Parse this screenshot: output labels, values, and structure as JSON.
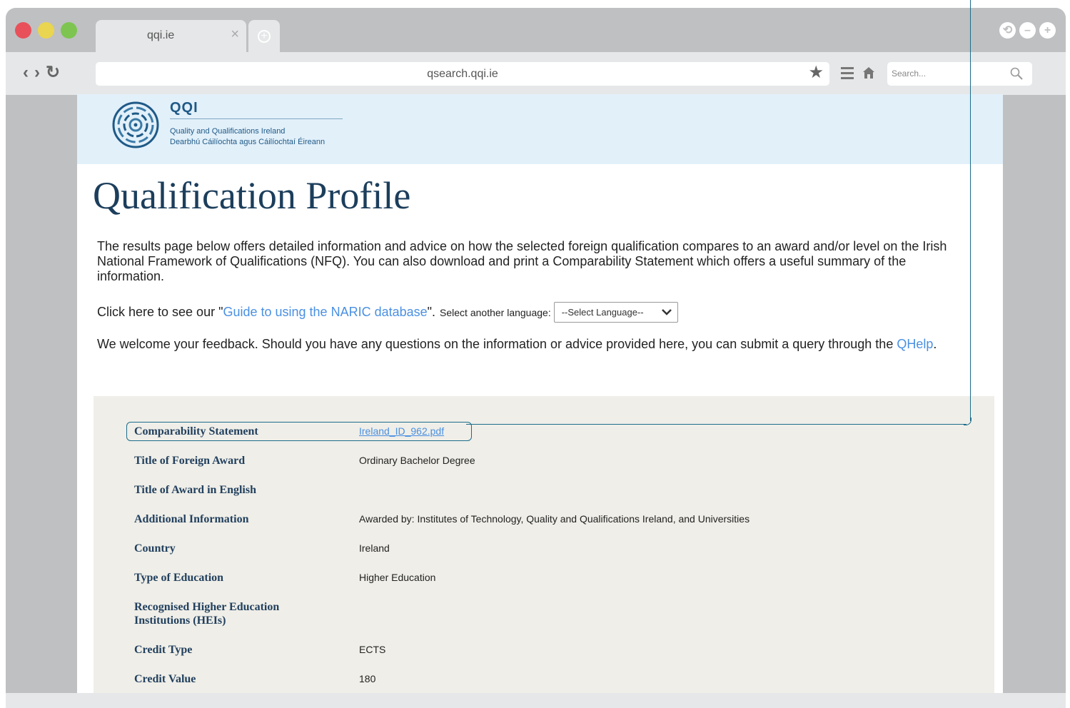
{
  "browser": {
    "tab_title": "qqi.ie",
    "tab_close": "×",
    "new_tab": "+",
    "address": "qsearch.qqi.ie",
    "search_placeholder": "Search...",
    "nav_back": "‹",
    "nav_forward": "›",
    "nav_reload": "↻",
    "star": "★",
    "traffic_colors": [
      "#e8515a",
      "#e9d54f",
      "#7dc550"
    ],
    "win_ctrl_icons": [
      "⟲",
      "–",
      "+"
    ]
  },
  "header": {
    "logo_name": "QQI",
    "logo_line1": "Quality and Qualifications Ireland",
    "logo_line2": "Dearbhú Cáilíochta agus Cáilíochtaí Éireann"
  },
  "page": {
    "title": "Qualification Profile",
    "intro": "The results page below offers detailed information and advice on how the selected foreign qualification compares to an award and/or level on the Irish National Framework of Qualifications (NFQ). You can also download and print a Comparability Statement which offers a useful summary of the information.",
    "guide_prefix": "Click here to see our \"",
    "guide_link": "Guide to using the NARIC database",
    "guide_suffix": "\".",
    "language_label": "Select another language:",
    "language_select": "--Select Language--",
    "feedback_text": "We welcome your feedback. Should you have any questions on the information or advice provided here, you can submit a query through the ",
    "feedback_link": "QHelp",
    "feedback_end": "."
  },
  "profile": {
    "rows": [
      {
        "label": "Comparability Statement",
        "value": "Ireland_ID_962.pdf"
      },
      {
        "label": "Title of Foreign Award",
        "value": "Ordinary Bachelor Degree"
      },
      {
        "label": "Title of Award in English",
        "value": ""
      },
      {
        "label": "Additional Information",
        "value": "Awarded by: Institutes of Technology, Quality and Qualifications Ireland, and Universities"
      },
      {
        "label": "Country",
        "value": "Ireland"
      },
      {
        "label": "Type of Education",
        "value": "Higher Education"
      },
      {
        "label": "Recognised Higher Education Institutions (HEIs)",
        "value": ""
      },
      {
        "label": "Credit Type",
        "value": "ECTS"
      },
      {
        "label": "Credit Value",
        "value": "180"
      }
    ]
  }
}
